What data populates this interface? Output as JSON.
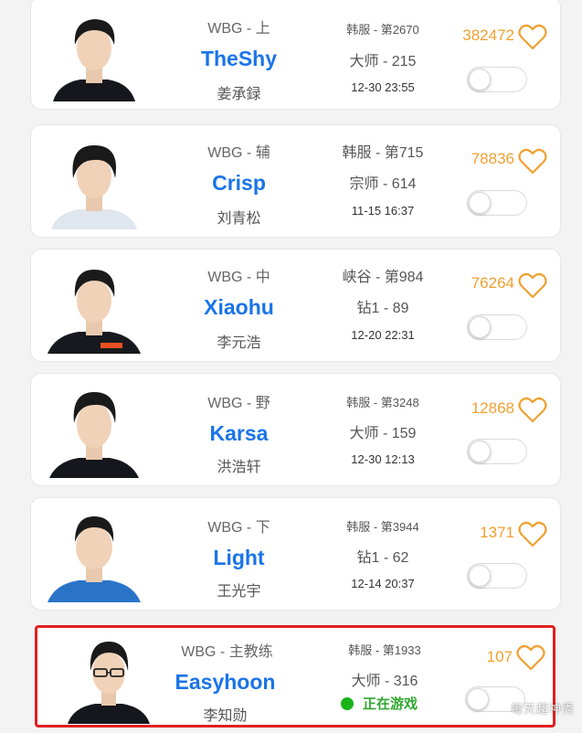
{
  "colors": {
    "name": "#1a74e8",
    "likes": "#f0a030",
    "status": "#2fa72f",
    "highlight_border": "#e02020"
  },
  "players": [
    {
      "team_role": "WBG - 上",
      "name": "TheShy",
      "real_name": "姜承録",
      "server": "韩服 - 第2670",
      "rank": "大师 - 215",
      "last_seen": "12-30 23:55",
      "likes": "382472",
      "icons": {
        "like": "heart-icon",
        "avatar": "player-avatar"
      }
    },
    {
      "team_role": "WBG - 辅",
      "name": "Crisp",
      "real_name": "刘青松",
      "server": "韩服 - 第715",
      "rank": "宗师 - 614",
      "last_seen": "11-15 16:37",
      "likes": "78836",
      "icons": {
        "like": "heart-icon",
        "avatar": "player-avatar"
      }
    },
    {
      "team_role": "WBG - 中",
      "name": "Xiaohu",
      "real_name": "李元浩",
      "server": "峡谷 - 第984",
      "rank": "钻1 - 89",
      "last_seen": "12-20 22:31",
      "likes": "76264",
      "icons": {
        "like": "heart-icon",
        "avatar": "player-avatar"
      }
    },
    {
      "team_role": "WBG - 野",
      "name": "Karsa",
      "real_name": "洪浩轩",
      "server": "韩服 - 第3248",
      "rank": "大师 - 159",
      "last_seen": "12-30 12:13",
      "likes": "12868",
      "icons": {
        "like": "heart-icon",
        "avatar": "player-avatar"
      }
    },
    {
      "team_role": "WBG - 下",
      "name": "Light",
      "real_name": "王光宇",
      "server": "韩服 - 第3944",
      "rank": "钻1 - 62",
      "last_seen": "12-14 20:37",
      "likes": "1371",
      "icons": {
        "like": "heart-icon",
        "avatar": "player-avatar"
      }
    },
    {
      "team_role": "WBG - 主教练",
      "name": "Easyhoon",
      "real_name": "李知勋",
      "server": "韩服 - 第1933",
      "rank": "大师 - 316",
      "status": "正在游戏",
      "likes": "107",
      "icons": {
        "like": "heart-icon",
        "avatar": "player-avatar",
        "status": "online-dot-icon"
      }
    }
  ],
  "watermark": "每天超神秀"
}
